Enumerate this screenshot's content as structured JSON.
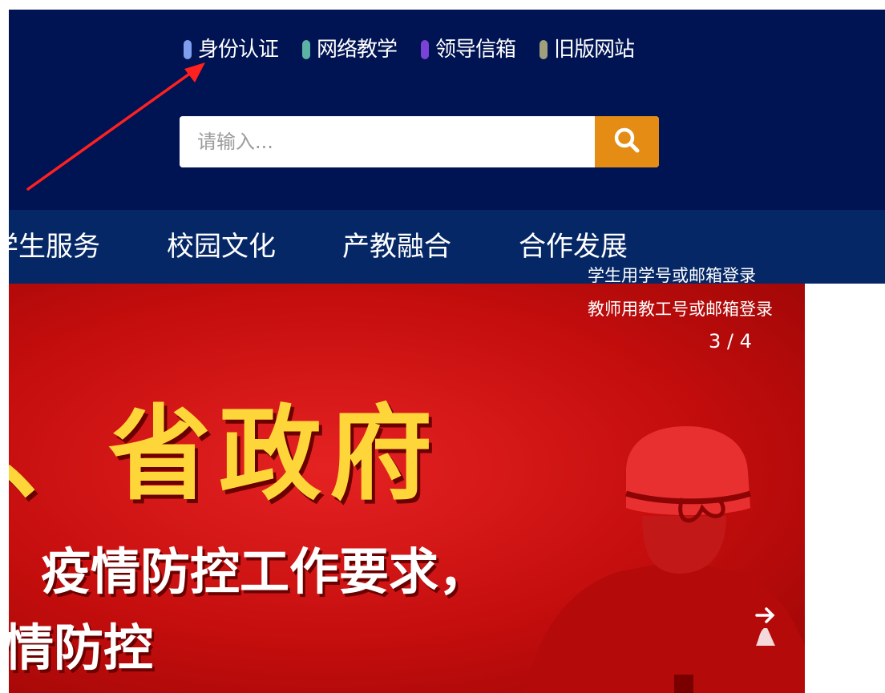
{
  "quick_links": [
    {
      "label": "身份认证",
      "icon": "pill-icon",
      "color": "#7f9ef0"
    },
    {
      "label": "网络教学",
      "icon": "pill-icon",
      "color": "#5cb3a4"
    },
    {
      "label": "领导信箱",
      "icon": "pill-icon",
      "color": "#7a42d6"
    },
    {
      "label": "旧版网站",
      "icon": "pill-icon",
      "color": "#9fa07b"
    }
  ],
  "search": {
    "placeholder": "请输入...",
    "value": "",
    "button_icon": "search-icon",
    "button_color": "#e48c13"
  },
  "nav": {
    "items": [
      {
        "label": "学生服务"
      },
      {
        "label": "校园文化"
      },
      {
        "label": "产教融合"
      },
      {
        "label": "合作发展"
      }
    ]
  },
  "banner": {
    "line1": "、省政府",
    "line2": "疫情防控工作要求，",
    "line3": "情防控",
    "next_icon": "arrow-right-icon"
  },
  "login_hints": {
    "student": "学生用学号或邮箱登录",
    "teacher": "教师用教工号或邮箱登录"
  },
  "slider": {
    "counter": "3 / 4"
  },
  "colors": {
    "header_bg": "#001352",
    "nav_bg": "#052766",
    "annotation_arrow": "#ff2020"
  }
}
